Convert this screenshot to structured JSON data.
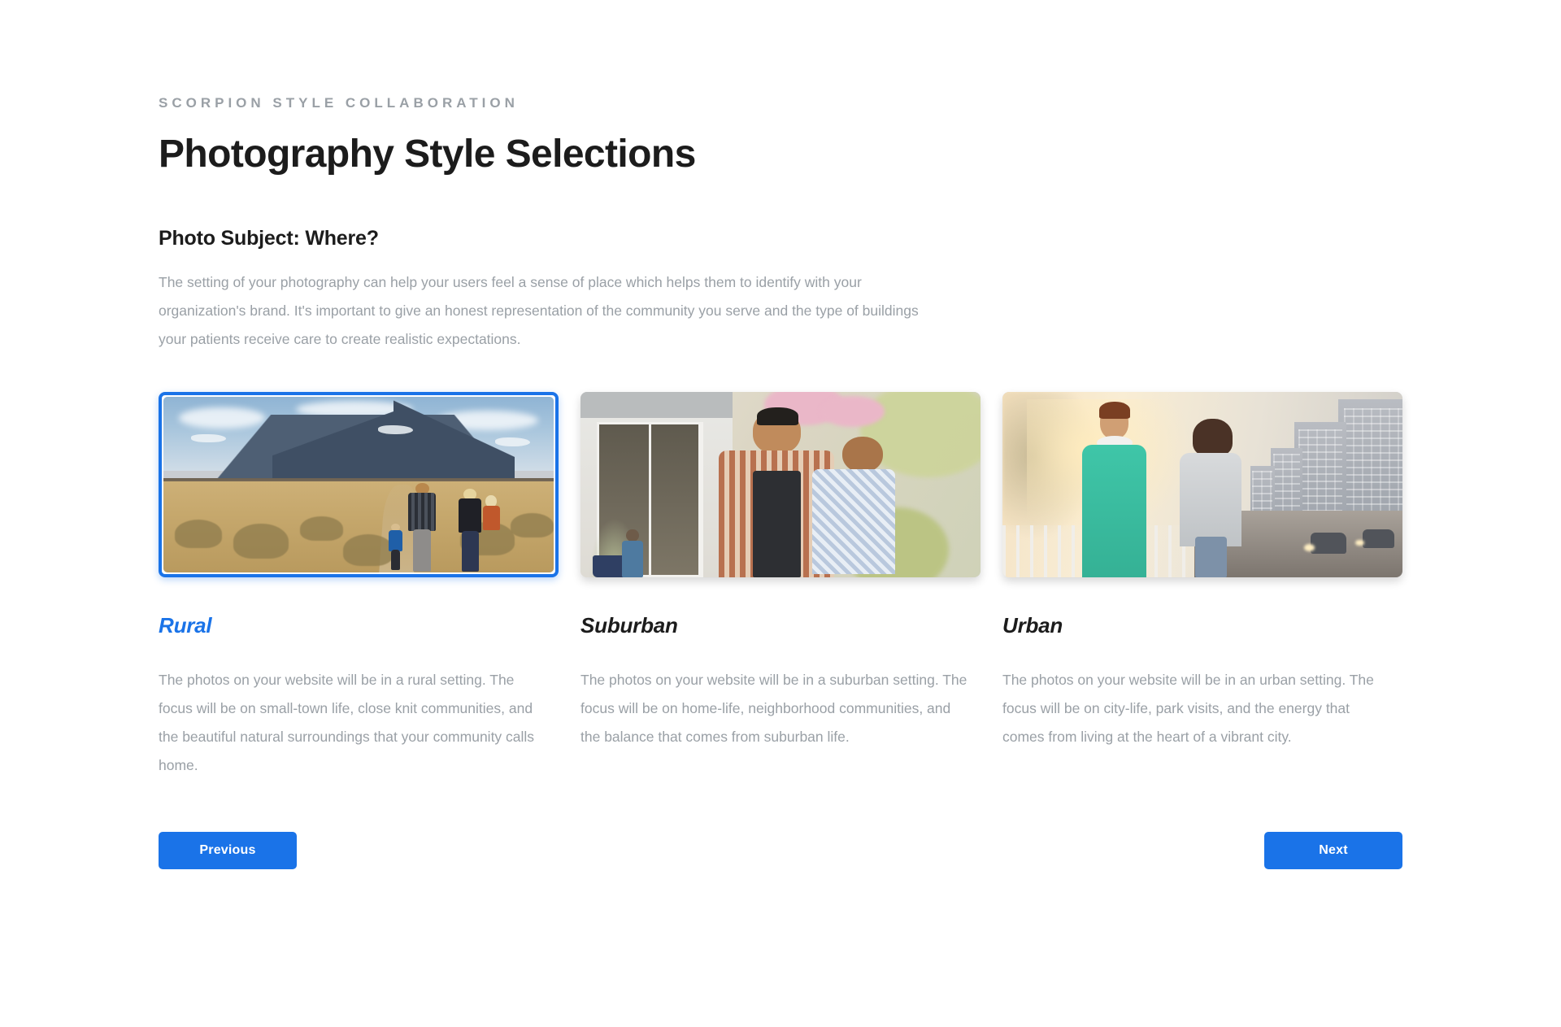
{
  "header": {
    "eyebrow": "SCORPION STYLE COLLABORATION",
    "title": "Photography Style Selections"
  },
  "section": {
    "title": "Photo Subject: Where?",
    "body": "The setting of your photography can help your users feel a sense of place which helps them to identify with your organization's brand. It's important to give an honest representation of the community you serve and the type of buildings your patients receive care to create realistic expectations."
  },
  "colors": {
    "accent": "#1a73e8",
    "text_dark": "#1c1c1c",
    "text_muted": "#9aa0a6",
    "background": "#ffffff"
  },
  "cards": [
    {
      "label": "Rural",
      "selected": true,
      "image_alt": "family-walking-rural-field-mountains-photo",
      "description": "The photos on your website will be in a rural setting. The focus will be on small-town life, close knit communities, and the beautiful natural surroundings that your community calls home."
    },
    {
      "label": "Suburban",
      "selected": false,
      "image_alt": "father-holding-laughing-son-backyard-photo",
      "description": "The photos on your website will be in a suburban setting. The focus will be on home-life, neighborhood communities, and the balance that comes from suburban life."
    },
    {
      "label": "Urban",
      "selected": false,
      "image_alt": "couple-jogging-city-bridge-sunset-photo",
      "description": "The photos on your website will be in an urban setting. The focus will be on city-life, park visits, and the energy that comes from living at the heart of a vibrant city."
    }
  ],
  "footer": {
    "previous_label": "Previous",
    "next_label": "Next"
  }
}
